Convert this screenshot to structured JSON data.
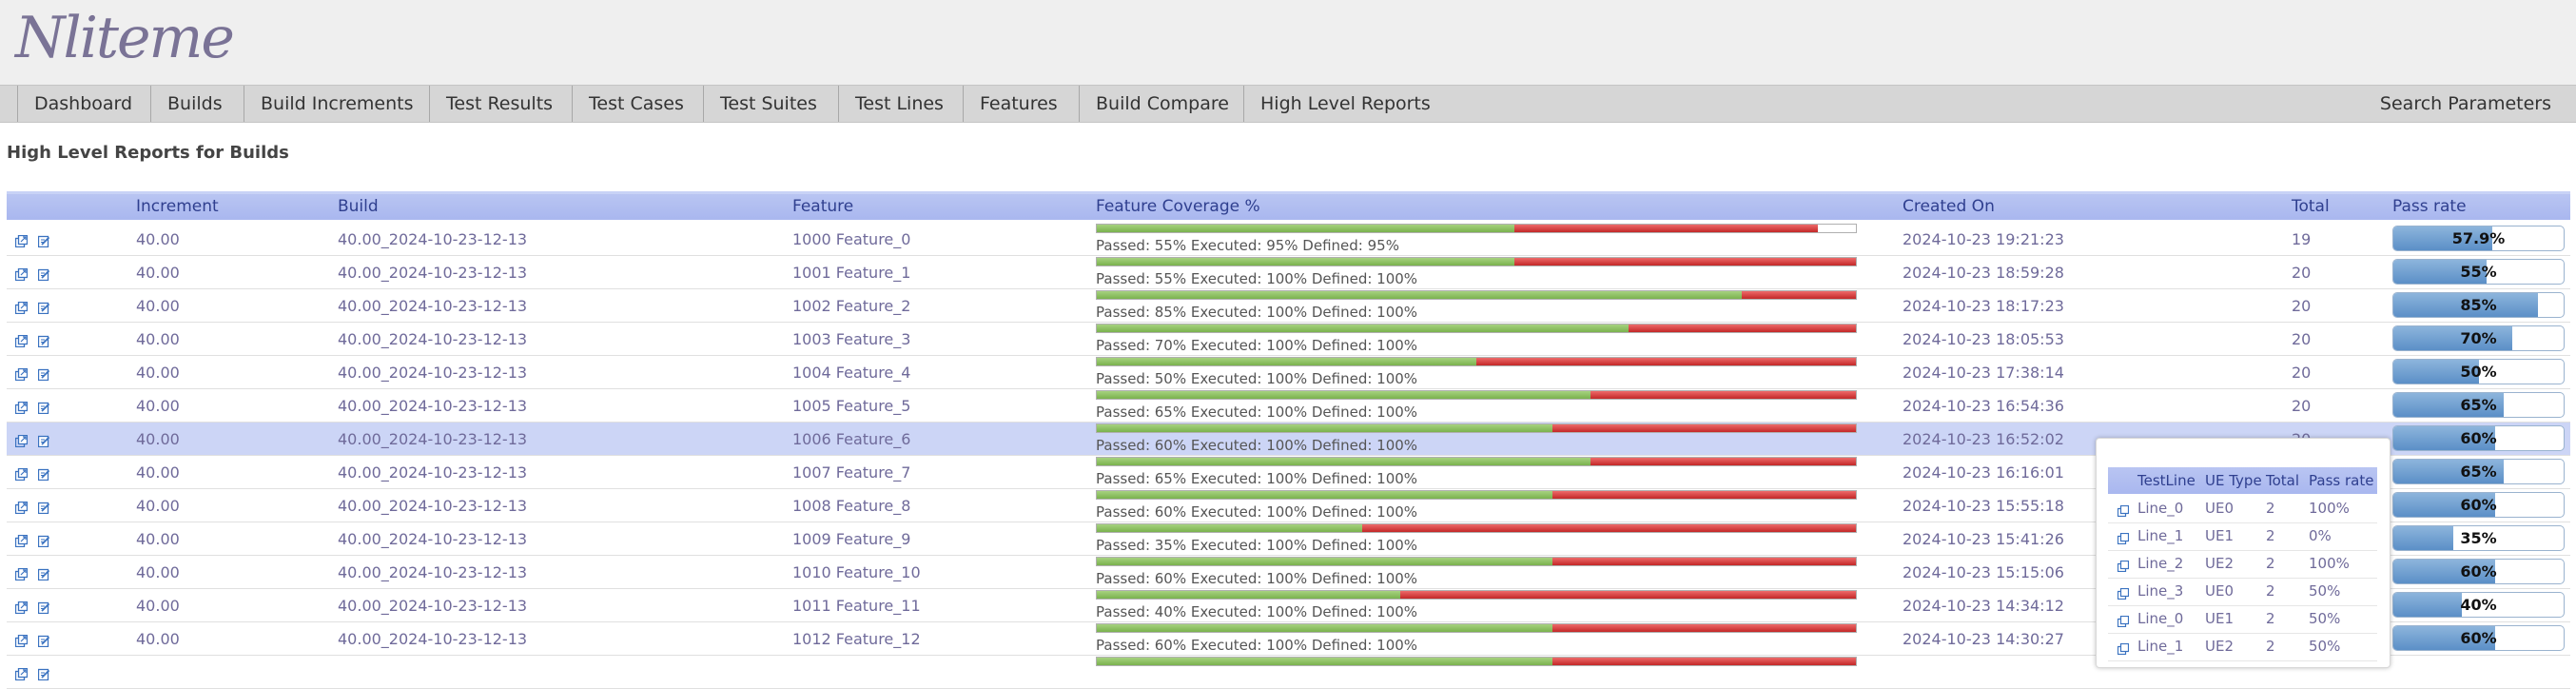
{
  "app": {
    "logo": "Nliteme"
  },
  "nav": {
    "items": [
      "Dashboard",
      "Builds",
      "Build Increments",
      "Test Results",
      "Test Cases",
      "Test Suites",
      "Test Lines",
      "Features",
      "Build Compare",
      "High Level Reports"
    ],
    "search": "Search Parameters"
  },
  "page": {
    "title": "High Level Reports for Builds"
  },
  "table": {
    "headers": {
      "increment": "Increment",
      "build": "Build",
      "feature": "Feature",
      "coverage": "Feature Coverage %",
      "created": "Created On",
      "total": "Total",
      "passrate": "Pass rate"
    },
    "rows": [
      {
        "increment": "40.00",
        "build": "40.00_2024-10-23-12-13",
        "feature": "1000 Feature_0",
        "passed": 55,
        "executed": 95,
        "coverage_text": "Passed: 55% Executed: 95% Defined: 95%",
        "created": "2024-10-23 19:21:23",
        "total": "19",
        "passrate": 57.9,
        "passrate_label": "57.9%"
      },
      {
        "increment": "40.00",
        "build": "40.00_2024-10-23-12-13",
        "feature": "1001 Feature_1",
        "passed": 55,
        "executed": 100,
        "coverage_text": "Passed: 55% Executed: 100% Defined: 100%",
        "created": "2024-10-23 18:59:28",
        "total": "20",
        "passrate": 55,
        "passrate_label": "55%"
      },
      {
        "increment": "40.00",
        "build": "40.00_2024-10-23-12-13",
        "feature": "1002 Feature_2",
        "passed": 85,
        "executed": 100,
        "coverage_text": "Passed: 85% Executed: 100% Defined: 100%",
        "created": "2024-10-23 18:17:23",
        "total": "20",
        "passrate": 85,
        "passrate_label": "85%"
      },
      {
        "increment": "40.00",
        "build": "40.00_2024-10-23-12-13",
        "feature": "1003 Feature_3",
        "passed": 70,
        "executed": 100,
        "coverage_text": "Passed: 70% Executed: 100% Defined: 100%",
        "created": "2024-10-23 18:05:53",
        "total": "20",
        "passrate": 70,
        "passrate_label": "70%"
      },
      {
        "increment": "40.00",
        "build": "40.00_2024-10-23-12-13",
        "feature": "1004 Feature_4",
        "passed": 50,
        "executed": 100,
        "coverage_text": "Passed: 50% Executed: 100% Defined: 100%",
        "created": "2024-10-23 17:38:14",
        "total": "20",
        "passrate": 50,
        "passrate_label": "50%"
      },
      {
        "increment": "40.00",
        "build": "40.00_2024-10-23-12-13",
        "feature": "1005 Feature_5",
        "passed": 65,
        "executed": 100,
        "coverage_text": "Passed: 65% Executed: 100% Defined: 100%",
        "created": "2024-10-23 16:54:36",
        "total": "20",
        "passrate": 65,
        "passrate_label": "65%"
      },
      {
        "increment": "40.00",
        "build": "40.00_2024-10-23-12-13",
        "feature": "1006 Feature_6",
        "passed": 60,
        "executed": 100,
        "coverage_text": "Passed: 60% Executed: 100% Defined: 100%",
        "created": "2024-10-23 16:52:02",
        "total": "20",
        "passrate": 60,
        "passrate_label": "60%",
        "selected": true
      },
      {
        "increment": "40.00",
        "build": "40.00_2024-10-23-12-13",
        "feature": "1007 Feature_7",
        "passed": 65,
        "executed": 100,
        "coverage_text": "Passed: 65% Executed: 100% Defined: 100%",
        "created": "2024-10-23 16:16:01",
        "total": "20",
        "passrate": 65,
        "passrate_label": "65%"
      },
      {
        "increment": "40.00",
        "build": "40.00_2024-10-23-12-13",
        "feature": "1008 Feature_8",
        "passed": 60,
        "executed": 100,
        "coverage_text": "Passed: 60% Executed: 100% Defined: 100%",
        "created": "2024-10-23 15:55:18",
        "total": "20",
        "passrate": 60,
        "passrate_label": "60%"
      },
      {
        "increment": "40.00",
        "build": "40.00_2024-10-23-12-13",
        "feature": "1009 Feature_9",
        "passed": 35,
        "executed": 100,
        "coverage_text": "Passed: 35% Executed: 100% Defined: 100%",
        "created": "2024-10-23 15:41:26",
        "total": "20",
        "passrate": 35,
        "passrate_label": "35%"
      },
      {
        "increment": "40.00",
        "build": "40.00_2024-10-23-12-13",
        "feature": "1010 Feature_10",
        "passed": 60,
        "executed": 100,
        "coverage_text": "Passed: 60% Executed: 100% Defined: 100%",
        "created": "2024-10-23 15:15:06",
        "total": "20",
        "passrate": 60,
        "passrate_label": "60%"
      },
      {
        "increment": "40.00",
        "build": "40.00_2024-10-23-12-13",
        "feature": "1011 Feature_11",
        "passed": 40,
        "executed": 100,
        "coverage_text": "Passed: 40% Executed: 100% Defined: 100%",
        "created": "2024-10-23 14:34:12",
        "total": "20",
        "passrate": 40,
        "passrate_label": "40%"
      },
      {
        "increment": "40.00",
        "build": "40.00_2024-10-23-12-13",
        "feature": "1012 Feature_12",
        "passed": 60,
        "executed": 100,
        "coverage_text": "Passed: 60% Executed: 100% Defined: 100%",
        "created": "2024-10-23 14:30:27",
        "total": "20",
        "passrate": 60,
        "passrate_label": "60%"
      },
      {
        "increment": "",
        "build": "",
        "feature": "",
        "passed": 60,
        "executed": 100,
        "coverage_text": "",
        "created": "",
        "total": "",
        "passrate": null,
        "passrate_label": ""
      }
    ]
  },
  "popup": {
    "headers": {
      "testline": "TestLine",
      "uetype": "UE Type",
      "total": "Total",
      "passrate": "Pass rate"
    },
    "rows": [
      {
        "testline": "Line_0",
        "uetype": "UE0",
        "total": "2",
        "passrate": "100%"
      },
      {
        "testline": "Line_1",
        "uetype": "UE1",
        "total": "2",
        "passrate": "0%"
      },
      {
        "testline": "Line_2",
        "uetype": "UE2",
        "total": "2",
        "passrate": "100%"
      },
      {
        "testline": "Line_3",
        "uetype": "UE0",
        "total": "2",
        "passrate": "50%"
      },
      {
        "testline": "Line_0",
        "uetype": "UE1",
        "total": "2",
        "passrate": "50%"
      },
      {
        "testline": "Line_1",
        "uetype": "UE2",
        "total": "2",
        "passrate": "50%"
      }
    ]
  },
  "colors": {
    "header_bg": "#efefef",
    "nav_bg": "#d6d6d6",
    "table_header": "#b3c0f1",
    "selected_row": "#ccd5f6",
    "pass_green": "#8cc063",
    "fail_red": "#d83a3a",
    "passrate_blue": "#6f9fd1",
    "link_text": "#6f6a9a"
  },
  "icons": {
    "open": "open-window-icon",
    "edit": "edit-note-icon"
  }
}
